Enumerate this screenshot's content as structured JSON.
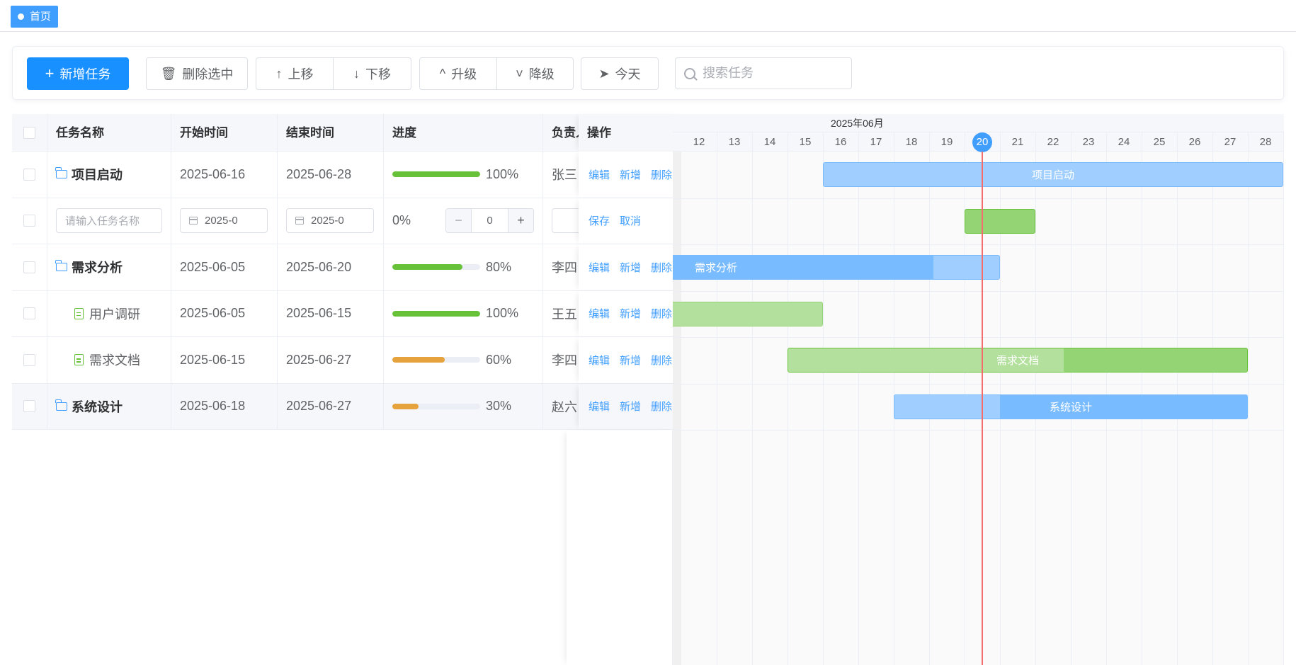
{
  "tabs": {
    "home": "首页"
  },
  "toolbar": {
    "add": "新增任务",
    "delete": "删除选中",
    "up": "上移",
    "down": "下移",
    "promote": "升级",
    "demote": "降级",
    "today": "今天",
    "search_placeholder": "搜索任务"
  },
  "table": {
    "headers": {
      "name": "任务名称",
      "start": "开始时间",
      "end": "结束时间",
      "progress": "进度",
      "owner": "负责人",
      "ops": "操作"
    },
    "ops": {
      "edit": "编辑",
      "add": "新增",
      "delete": "删除",
      "save": "保存",
      "cancel": "取消"
    },
    "rows": [
      {
        "name": "项目启动",
        "type": "folder",
        "start": "2025-06-16",
        "end": "2025-06-28",
        "progress": 100,
        "progress_text": "100%",
        "owner": "张三",
        "color": "#67c23a"
      },
      {
        "editing": true,
        "name_placeholder": "请输入任务名称",
        "start": "2025-0",
        "end": "2025-0",
        "progress_text": "0%",
        "stepper_value": "0"
      },
      {
        "name": "需求分析",
        "type": "folder",
        "start": "2025-06-05",
        "end": "2025-06-20",
        "progress": 80,
        "progress_text": "80%",
        "owner": "李四",
        "color": "#67c23a"
      },
      {
        "name": "用户调研",
        "type": "file",
        "start": "2025-06-05",
        "end": "2025-06-15",
        "progress": 100,
        "progress_text": "100%",
        "owner": "王五",
        "color": "#67c23a"
      },
      {
        "name": "需求文档",
        "type": "file",
        "start": "2025-06-15",
        "end": "2025-06-27",
        "progress": 60,
        "progress_text": "60%",
        "owner": "李四",
        "color": "#e6a23c"
      },
      {
        "name": "系统设计",
        "type": "folder",
        "start": "2025-06-18",
        "end": "2025-06-27",
        "progress": 30,
        "progress_text": "30%",
        "owner": "赵六",
        "color": "#e6a23c"
      }
    ]
  },
  "gantt": {
    "month": "2025年06月",
    "days": [
      "12",
      "13",
      "14",
      "15",
      "16",
      "17",
      "18",
      "19",
      "20",
      "21",
      "22",
      "23",
      "24",
      "25",
      "26",
      "27",
      "28"
    ],
    "today": "20",
    "bars": [
      {
        "label": "项目启动",
        "color": "#a0cfff",
        "done": "#a0cfff",
        "border": "#79bbff",
        "progress": 100
      },
      {
        "label": "",
        "color": "#95d475",
        "done": "#95d475",
        "border": "#67c23a",
        "progress": 100
      },
      {
        "label": "需求分析",
        "color": "#a0cfff",
        "done": "#79bbff",
        "border": "#79bbff",
        "progress": 80
      },
      {
        "label": "",
        "color": "#b3e19d",
        "done": "#b3e19d",
        "border": "#95d475",
        "progress": 100
      },
      {
        "label": "需求文档",
        "color": "#95d475",
        "done": "#b3e19d",
        "border": "#67c23a",
        "progress": 60
      },
      {
        "label": "系统设计",
        "color": "#79bbff",
        "done": "#a0cfff",
        "border": "#79bbff",
        "progress": 30
      }
    ]
  }
}
